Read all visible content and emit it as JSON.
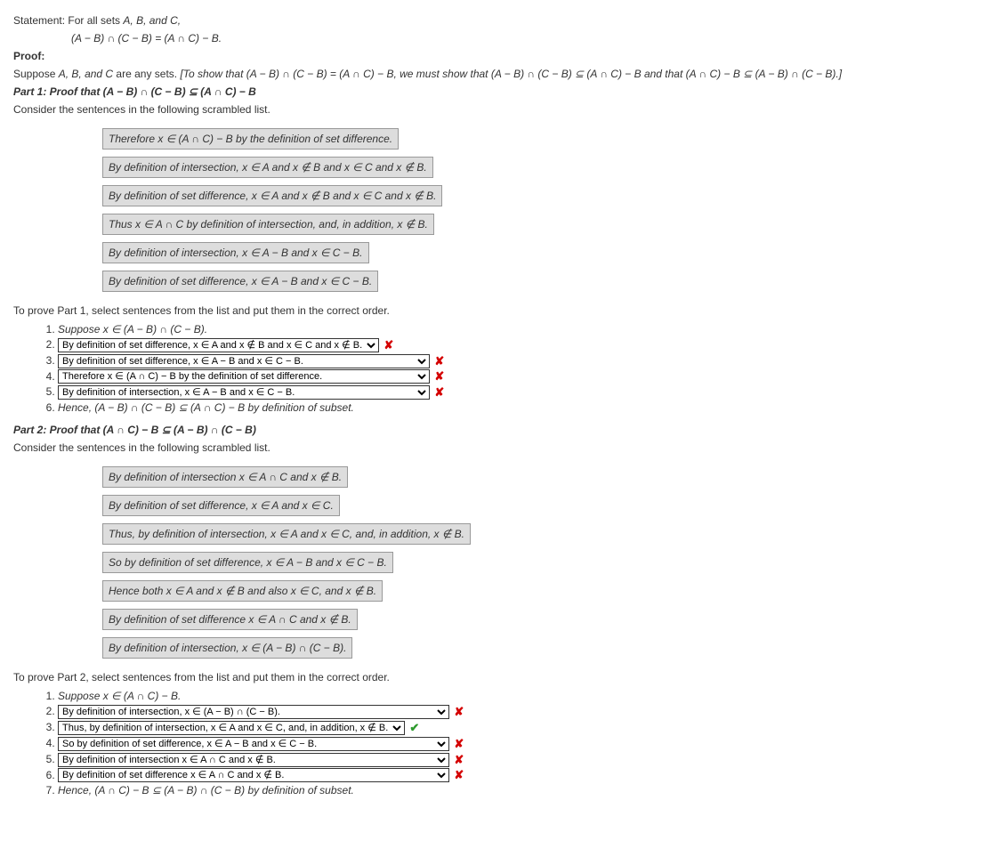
{
  "statement": {
    "prefix": "Statement: For all sets ",
    "vars": "A, B, and C,",
    "equation": "(A − B) ∩ (C − B) = (A ∩ C) − B."
  },
  "proof_label": "Proof:",
  "suppose_prefix": "Suppose ",
  "suppose_vars": "A, B, and C",
  "suppose_suffix": " are any sets. ",
  "to_show": "[To show that (A − B) ∩ (C − B) = (A ∩ C) − B, we must show that (A − B) ∩ (C − B) ⊆ (A ∩ C) − B and that (A ∩ C) − B ⊆ (A − B) ∩ (C − B).]",
  "part1": {
    "heading": "Part 1: Proof that (A − B) ∩ (C − B) ⊆ (A ∩ C) − B",
    "consider": "Consider the sentences in the following scrambled list.",
    "boxes": [
      "Therefore x ∈ (A ∩ C) − B by the definition of set difference.",
      "By definition of intersection, x ∈ A and x ∉ B and x ∈ C and x ∉ B.",
      "By definition of set difference, x ∈ A and x ∉ B and x ∈ C and x ∉ B.",
      "Thus x ∈ A ∩ C by definition of intersection, and, in addition, x ∉ B.",
      "By definition of intersection, x ∈ A − B and x ∈ C − B.",
      "By definition of set difference, x ∈ A − B and x ∈ C − B."
    ],
    "instructions": "To prove Part 1, select sentences from the list and put them in the correct order.",
    "step1": "Suppose x ∈ (A − B) ∩ (C − B).",
    "s2": "By definition of set difference, x ∈ A and x ∉ B and x ∈ C and x ∉ B.",
    "s3": "By definition of set difference, x ∈ A − B and x ∈ C − B.",
    "s4": "Therefore x ∈ (A ∩ C) − B by the definition of set difference.",
    "s5": "By definition of intersection, x ∈ A − B and x ∈ C − B.",
    "step6": "Hence, (A − B) ∩ (C − B) ⊆ (A ∩ C) − B by definition of subset."
  },
  "part2": {
    "heading": "Part 2: Proof that (A ∩ C) − B ⊆ (A − B) ∩ (C − B)",
    "consider": "Consider the sentences in the following scrambled list.",
    "boxes": [
      "By definition of intersection x ∈ A ∩ C and x ∉ B.",
      "By definition of set difference, x ∈ A and x ∈ C.",
      "Thus, by definition of intersection, x ∈ A and x ∈ C, and, in addition, x ∉ B.",
      "So by definition of set difference, x ∈ A − B and x ∈ C − B.",
      "Hence both x ∈ A and x ∉ B and also x ∈ C, and x ∉ B.",
      "By definition of set difference x ∈ A ∩ C and x ∉ B.",
      "By definition of intersection, x ∈ (A − B) ∩ (C − B)."
    ],
    "instructions": "To prove Part 2, select sentences from the list and put them in the correct order.",
    "step1": "Suppose x ∈ (A ∩ C) − B.",
    "s2": "By definition of intersection, x ∈ (A − B) ∩ (C − B).",
    "s3": "Thus, by definition of intersection, x ∈ A and x ∈ C, and, in addition, x ∉ B.",
    "s4": "So by definition of set difference, x ∈ A − B and x ∈ C − B.",
    "s5": "By definition of intersection x ∈ A ∩ C and x ∉ B.",
    "s6": "By definition of set difference x ∈ A ∩ C and x ∉ B.",
    "step7": "Hence, (A ∩ C) − B ⊆ (A − B) ∩ (C − B) by definition of subset."
  },
  "marks": {
    "wrong": "✘",
    "correct": "✔"
  }
}
